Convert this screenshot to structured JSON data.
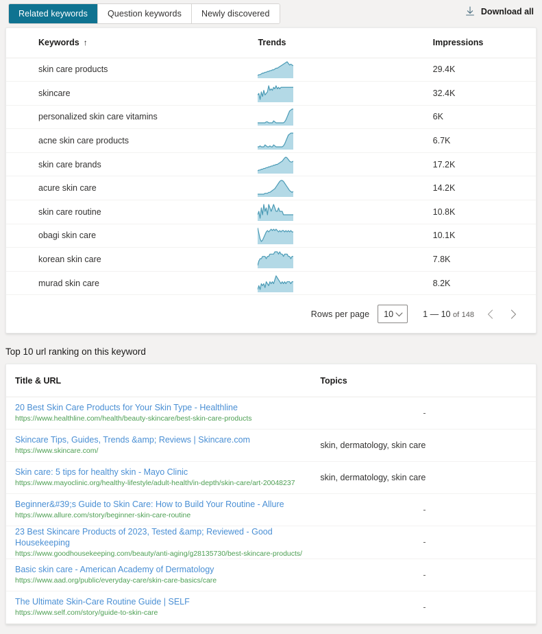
{
  "tabs": [
    {
      "label": "Related keywords",
      "active": true
    },
    {
      "label": "Question keywords",
      "active": false
    },
    {
      "label": "Newly discovered",
      "active": false
    }
  ],
  "download": {
    "label": "Download all",
    "icon": "download-icon"
  },
  "keyword_table": {
    "columns": {
      "keywords": "Keywords",
      "sort_indicator": "↑",
      "trends": "Trends",
      "impressions": "Impressions"
    },
    "rows": [
      {
        "keyword": "skin care products",
        "impressions": "29.4K",
        "trend": [
          18,
          17,
          17,
          16,
          15,
          15,
          14,
          14,
          13,
          13,
          12,
          12,
          11,
          11,
          10,
          9,
          9,
          8,
          7,
          6,
          5,
          4,
          3,
          2,
          1,
          3,
          5,
          4,
          5,
          6
        ]
      },
      {
        "keyword": "skincare",
        "impressions": "32.4K",
        "trend": [
          11,
          10,
          14,
          9,
          12,
          8,
          11,
          10,
          9,
          5,
          8,
          7,
          8,
          6,
          7,
          5,
          7,
          6,
          7,
          6,
          6,
          6,
          6,
          6,
          6,
          6,
          6,
          6,
          6,
          6
        ]
      },
      {
        "keyword": "personalized skin care vitamins",
        "impressions": "6K",
        "trend": [
          16,
          16,
          16,
          16,
          16,
          16,
          16,
          15,
          15,
          16,
          16,
          16,
          16,
          14,
          15,
          16,
          16,
          16,
          16,
          16,
          16,
          16,
          15,
          13,
          10,
          7,
          4,
          3,
          2,
          2
        ]
      },
      {
        "keyword": "acne skin care products",
        "impressions": "6.7K",
        "trend": [
          16,
          16,
          15,
          16,
          16,
          16,
          14,
          15,
          16,
          16,
          15,
          16,
          16,
          14,
          15,
          16,
          16,
          16,
          16,
          16,
          16,
          15,
          13,
          10,
          7,
          4,
          3,
          2,
          2,
          2
        ]
      },
      {
        "keyword": "skin care brands",
        "impressions": "17.2K",
        "trend": [
          18,
          17,
          17,
          16,
          16,
          15,
          15,
          14,
          14,
          13,
          13,
          12,
          12,
          11,
          11,
          10,
          10,
          9,
          8,
          7,
          6,
          4,
          2,
          1,
          2,
          4,
          6,
          7,
          7,
          6
        ]
      },
      {
        "keyword": "acure skin care",
        "impressions": "14.2K",
        "trend": [
          17,
          17,
          17,
          17,
          17,
          17,
          16,
          16,
          16,
          15,
          15,
          14,
          13,
          12,
          11,
          9,
          7,
          5,
          3,
          2,
          2,
          3,
          5,
          7,
          9,
          11,
          13,
          14,
          15,
          14
        ]
      },
      {
        "keyword": "skin care routine",
        "impressions": "10.8K",
        "trend": [
          11,
          10,
          12,
          9,
          11,
          8,
          10,
          9,
          11,
          8,
          9,
          10,
          9,
          8,
          9,
          10,
          10,
          9,
          10,
          10,
          10,
          11,
          11,
          11,
          11,
          11,
          11,
          11,
          11,
          11
        ]
      },
      {
        "keyword": "obagi skin care",
        "impressions": "10.1K",
        "trend": [
          4,
          8,
          12,
          14,
          13,
          11,
          9,
          7,
          6,
          7,
          6,
          5,
          6,
          5,
          6,
          5,
          6,
          7,
          6,
          7,
          6,
          6,
          7,
          6,
          7,
          6,
          7,
          6,
          7,
          7
        ]
      },
      {
        "keyword": "korean skin care",
        "impressions": "7.8K",
        "trend": [
          12,
          10,
          9,
          9,
          8,
          8,
          8,
          9,
          8,
          8,
          7,
          7,
          7,
          7,
          6,
          6,
          6,
          7,
          6,
          7,
          7,
          8,
          7,
          7,
          7,
          8,
          8,
          9,
          8,
          8
        ]
      },
      {
        "keyword": "murad skin care",
        "impressions": "8.2K",
        "trend": [
          12,
          10,
          12,
          9,
          10,
          9,
          11,
          8,
          9,
          10,
          8,
          9,
          8,
          9,
          7,
          5,
          6,
          7,
          8,
          9,
          8,
          9,
          8,
          9,
          8,
          8,
          8,
          9,
          8,
          8
        ]
      }
    ]
  },
  "pagination": {
    "rows_per_page_label": "Rows per page",
    "rows_per_page_value": "10",
    "range": "1 — 10",
    "of_label": "of",
    "total": "148",
    "prev_icon": "chevron-left-icon",
    "next_icon": "chevron-right-icon"
  },
  "url_section": {
    "title": "Top 10 url ranking on this keyword",
    "columns": {
      "title_url": "Title & URL",
      "topics": "Topics"
    },
    "rows": [
      {
        "title": "20 Best Skin Care Products for Your Skin Type - Healthline",
        "url": "https://www.healthline.com/health/beauty-skincare/best-skin-care-products",
        "topics": "-"
      },
      {
        "title": "Skincare Tips, Guides, Trends &amp; Reviews | Skincare.com",
        "url": "https://www.skincare.com/",
        "topics": "skin, dermatology, skin care"
      },
      {
        "title": "Skin care: 5 tips for healthy skin - Mayo Clinic",
        "url": "https://www.mayoclinic.org/healthy-lifestyle/adult-health/in-depth/skin-care/art-20048237",
        "topics": "skin, dermatology, skin care"
      },
      {
        "title": "Beginner&#39;s Guide to Skin Care: How to Build Your Routine - Allure",
        "url": "https://www.allure.com/story/beginner-skin-care-routine",
        "topics": "-"
      },
      {
        "title": "23 Best Skincare Products of 2023, Tested &amp; Reviewed - Good Housekeeping",
        "url": "https://www.goodhousekeeping.com/beauty/anti-aging/g28135730/best-skincare-products/",
        "topics": "-"
      },
      {
        "title": "Basic skin care - American Academy of Dermatology",
        "url": "https://www.aad.org/public/everyday-care/skin-care-basics/care",
        "topics": "-"
      },
      {
        "title": "The Ultimate Skin-Care Routine Guide | SELF",
        "url": "https://www.self.com/story/guide-to-skin-care",
        "topics": "-"
      }
    ]
  },
  "colors": {
    "accent_teal": "#0f7391",
    "page_bg": "#f3f2f1",
    "spark_line": "#4a9ab5",
    "spark_fill": "#b3d9e6",
    "link_blue": "#4a8fd4",
    "url_green": "#4c9e52"
  }
}
